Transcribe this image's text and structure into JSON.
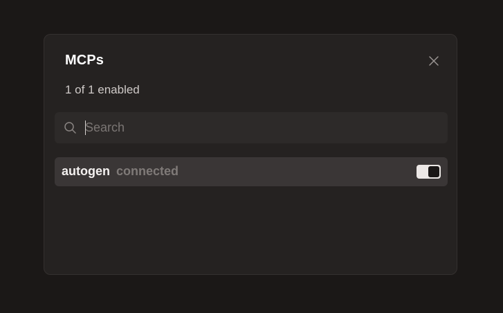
{
  "dialog": {
    "title": "MCPs",
    "subtitle": "1 of 1 enabled",
    "close_icon": "close-icon"
  },
  "search": {
    "placeholder": "Search",
    "value": "",
    "icon": "search-icon"
  },
  "items": [
    {
      "name": "autogen",
      "status": "connected",
      "enabled": true
    }
  ],
  "colors": {
    "background": "#1b1817",
    "dialog": "#252221",
    "search_bg": "#2d2a29",
    "row_bg": "#3a3636",
    "toggle_on": "#ece8e6"
  }
}
